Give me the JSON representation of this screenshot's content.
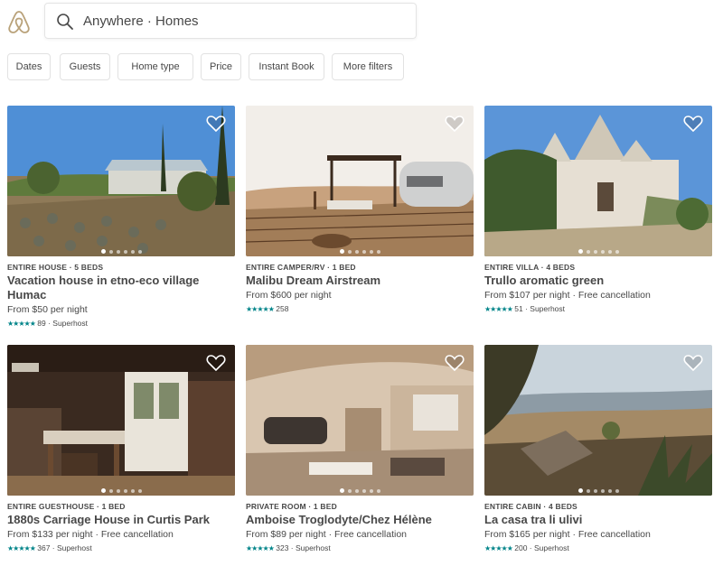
{
  "search": {
    "text": "Anywhere · Homes"
  },
  "filters": [
    {
      "label": "Dates"
    },
    {
      "label": "Guests"
    },
    {
      "label": "Home type"
    },
    {
      "label": "Price"
    },
    {
      "label": "Instant Book"
    },
    {
      "label": "More filters"
    }
  ],
  "listings": [
    {
      "kind": "ENTIRE HOUSE · 5 BEDS",
      "title": "Vacation house in etno-eco village Humac",
      "price": "From $50  per night",
      "stars": "★★★★★",
      "reviews": "89",
      "badge": "· Superhost"
    },
    {
      "kind": "ENTIRE CAMPER/RV · 1 BED",
      "title": "Malibu Dream Airstream",
      "price": "From $600  per night",
      "stars": "★★★★★",
      "reviews": "258",
      "badge": ""
    },
    {
      "kind": "ENTIRE VILLA · 4 BEDS",
      "title": "Trullo aromatic green",
      "price": "From $107  per night · Free cancellation",
      "stars": "★★★★★",
      "reviews": "51",
      "badge": "· Superhost"
    },
    {
      "kind": "ENTIRE GUESTHOUSE · 1 BED",
      "title": "1880s Carriage House in Curtis Park",
      "price": "From $133  per night · Free cancellation",
      "stars": "★★★★★",
      "reviews": "367",
      "badge": "· Superhost"
    },
    {
      "kind": "PRIVATE ROOM · 1 BED",
      "title": "Amboise Troglodyte/Chez Hélène",
      "price": "From $89  per night · Free cancellation",
      "stars": "★★★★★",
      "reviews": "323",
      "badge": "· Superhost"
    },
    {
      "kind": "ENTIRE CABIN · 4 BEDS",
      "title": "La casa tra li ulivi",
      "price": "From $165  per night · Free cancellation",
      "stars": "★★★★★",
      "reviews": "200",
      "badge": "· Superhost"
    }
  ],
  "icons": {
    "logo": "airbnb-logo",
    "search": "search-icon",
    "favorite": "heart-icon"
  },
  "colors": {
    "text": "#484848",
    "stars": "#008489",
    "brand": "#ff5a5f"
  }
}
